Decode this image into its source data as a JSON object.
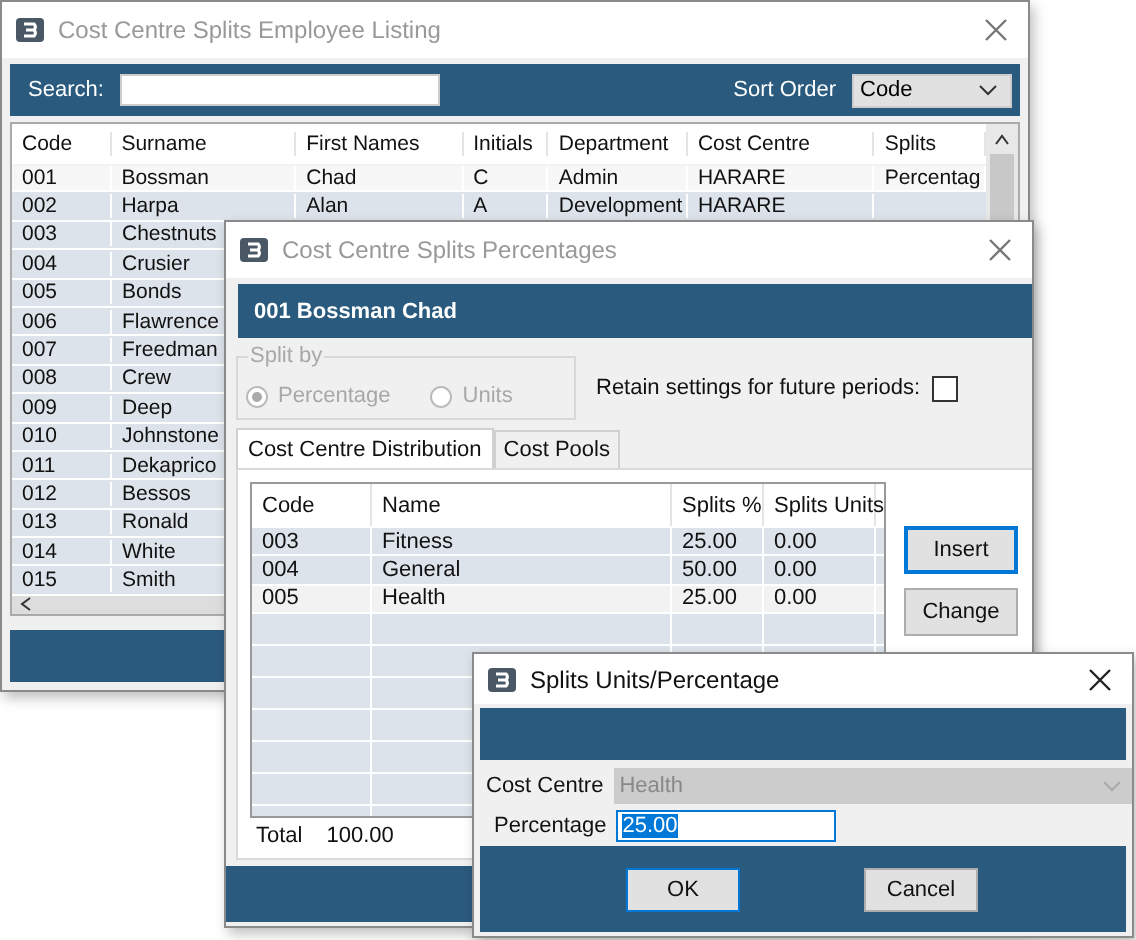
{
  "windows": [
    {
      "kind": "listing",
      "title": "Cost Centre Splits Employee Listing",
      "active": false,
      "search_label": "Search:",
      "sort": {
        "label": "Sort Order",
        "value": "Code"
      },
      "columns": [
        "Code",
        "Surname",
        "First Names",
        "Initials",
        "Department",
        "Cost Centre",
        "Splits"
      ],
      "rows": [
        {
          "cells": [
            "001",
            "Bossman",
            "Chad",
            "C",
            "Admin",
            "HARARE",
            "Percentag"
          ],
          "selected": true
        },
        {
          "cells": [
            "002",
            "Harpa",
            "Alan",
            "A",
            "Development",
            "HARARE",
            ""
          ],
          "selected": false
        },
        {
          "cells": [
            "003",
            "Chestnuts"
          ],
          "selected": false
        },
        {
          "cells": [
            "004",
            "Crusier"
          ],
          "selected": false
        },
        {
          "cells": [
            "005",
            "Bonds"
          ],
          "selected": false
        },
        {
          "cells": [
            "006",
            "Flawrence"
          ],
          "selected": false
        },
        {
          "cells": [
            "007",
            "Freedman"
          ],
          "selected": false
        },
        {
          "cells": [
            "008",
            "Crew"
          ],
          "selected": false
        },
        {
          "cells": [
            "009",
            "Deep"
          ],
          "selected": false
        },
        {
          "cells": [
            "010",
            "Johnstone"
          ],
          "selected": false
        },
        {
          "cells": [
            "011",
            "Dekaprico"
          ],
          "selected": false
        },
        {
          "cells": [
            "012",
            "Bessos"
          ],
          "selected": false
        },
        {
          "cells": [
            "013",
            "Ronald"
          ],
          "selected": false
        },
        {
          "cells": [
            "014",
            "White"
          ],
          "selected": false
        },
        {
          "cells": [
            "015",
            "Smith"
          ],
          "selected": false
        }
      ]
    },
    {
      "kind": "splits",
      "title": "Cost Centre Splits Percentages",
      "active": false,
      "header": "001 Bossman Chad",
      "split_by": {
        "label": "Split by",
        "disabled": true,
        "options": [
          {
            "label": "Percentage",
            "selected": true
          },
          {
            "label": "Units",
            "selected": false
          }
        ]
      },
      "retain": {
        "label": "Retain settings for future periods:",
        "checked": false
      },
      "tabs": [
        {
          "label": "Cost Centre Distribution",
          "selected": true
        },
        {
          "label": "Cost Pools",
          "selected": false
        }
      ],
      "columns": [
        "Code",
        "Name",
        "Splits %",
        "Splits Units"
      ],
      "rows": [
        {
          "cells": [
            "003",
            "Fitness",
            "25.00",
            "0.00"
          ],
          "selected": false
        },
        {
          "cells": [
            "004",
            "General",
            "50.00",
            "0.00"
          ],
          "selected": false
        },
        {
          "cells": [
            "005",
            "Health",
            "25.00",
            "0.00"
          ],
          "selected": true
        }
      ],
      "buttons": [
        {
          "label": "Insert",
          "focused": true
        },
        {
          "label": "Change",
          "focused": false
        }
      ],
      "total": {
        "label": "Total",
        "value": "100.00"
      }
    },
    {
      "kind": "edit",
      "title": "Splits Units/Percentage",
      "active": true,
      "fields": [
        {
          "kind": "combo",
          "label": "Cost Centre",
          "value": "Health",
          "disabled": true
        },
        {
          "kind": "text",
          "label": "Percentage",
          "value": "25.00",
          "disabled": false,
          "text_selected": true
        }
      ],
      "buttons": [
        {
          "label": "OK",
          "focused": true
        },
        {
          "label": "Cancel",
          "focused": false
        }
      ]
    }
  ]
}
